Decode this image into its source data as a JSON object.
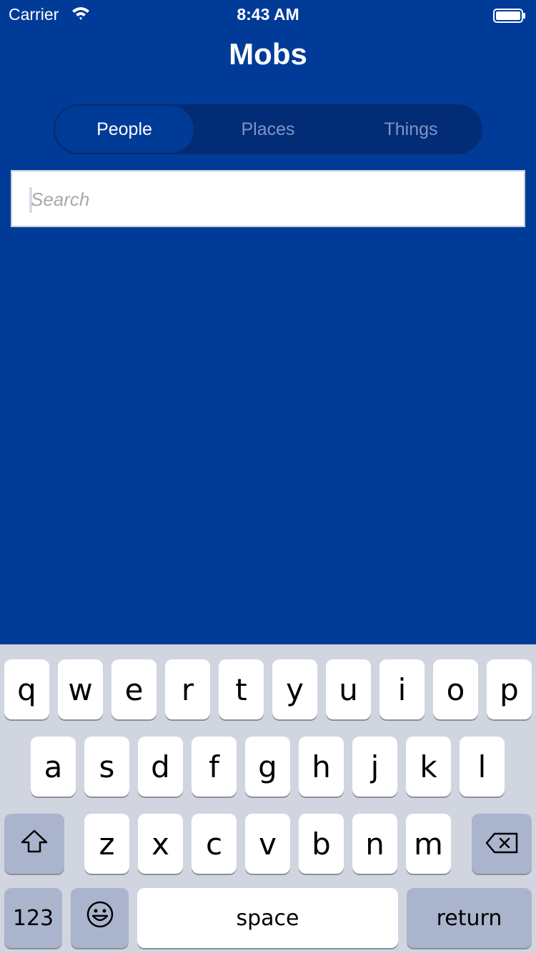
{
  "status_bar": {
    "carrier": "Carrier",
    "time": "8:43 AM"
  },
  "header": {
    "title": "Mobs"
  },
  "segments": [
    {
      "label": "People",
      "selected": true
    },
    {
      "label": "Places",
      "selected": false
    },
    {
      "label": "Things",
      "selected": false
    }
  ],
  "search": {
    "placeholder": "Search",
    "value": ""
  },
  "keyboard": {
    "row1": [
      "q",
      "w",
      "e",
      "r",
      "t",
      "y",
      "u",
      "i",
      "o",
      "p"
    ],
    "row2": [
      "a",
      "s",
      "d",
      "f",
      "g",
      "h",
      "j",
      "k",
      "l"
    ],
    "row3": [
      "z",
      "x",
      "c",
      "v",
      "b",
      "n",
      "m"
    ],
    "numbers_label": "123",
    "space_label": "space",
    "return_label": "return",
    "icons": {
      "shift": "shift-icon",
      "delete": "backspace-icon",
      "emoji": "emoji-icon"
    }
  },
  "colors": {
    "background": "#003b98",
    "segment_track": "#032c77",
    "keyboard_bg": "#d1d5e0"
  }
}
